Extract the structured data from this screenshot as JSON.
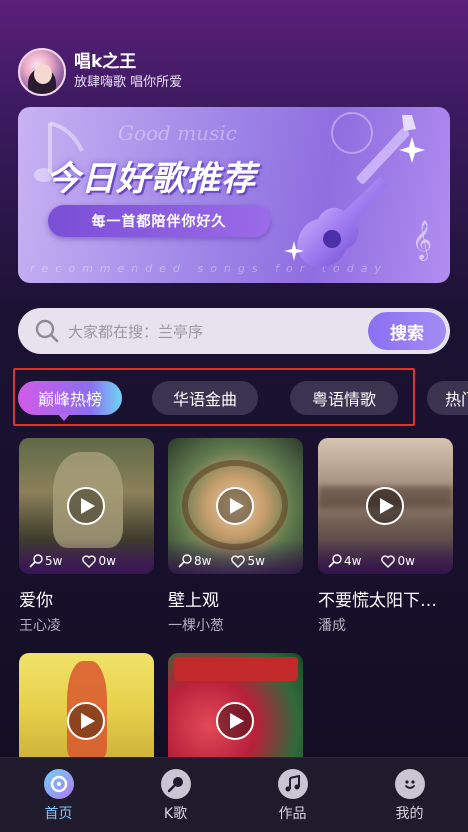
{
  "user": {
    "name": "唱k之王",
    "slogan": "放肆嗨歌 唱你所爱"
  },
  "banner": {
    "bg_text": "Good music",
    "title": "今日好歌推荐",
    "subtitle": "每一首都陪伴你好久",
    "english": "recommended songs for today"
  },
  "search": {
    "placeholder": "大家都在搜：兰亭序",
    "button": "搜索"
  },
  "tabs": [
    {
      "label": "巅峰热榜"
    },
    {
      "label": "华语金曲"
    },
    {
      "label": "粤语情歌"
    },
    {
      "label": "热门"
    }
  ],
  "songs": [
    {
      "title": "爱你",
      "artist": "王心凌",
      "mic": "5w",
      "likes": "0w"
    },
    {
      "title": "壁上观",
      "artist": "一棵小葱",
      "mic": "8w",
      "likes": "5w"
    },
    {
      "title": "不要慌太阳下…",
      "artist": "潘成",
      "mic": "4w",
      "likes": "0w"
    },
    {
      "title": "",
      "artist": "",
      "mic": "",
      "likes": ""
    },
    {
      "title": "",
      "artist": "",
      "mic": "",
      "likes": ""
    }
  ],
  "nav": [
    {
      "label": "首页",
      "icon": "music-disc-icon"
    },
    {
      "label": "K歌",
      "icon": "microphone-icon"
    },
    {
      "label": "作品",
      "icon": "music-note-icon"
    },
    {
      "label": "我的",
      "icon": "smile-icon"
    }
  ],
  "colors": {
    "accent": "#8a6ff0",
    "nav_active": "#7fc3f5",
    "highlight_border": "#e33326"
  }
}
